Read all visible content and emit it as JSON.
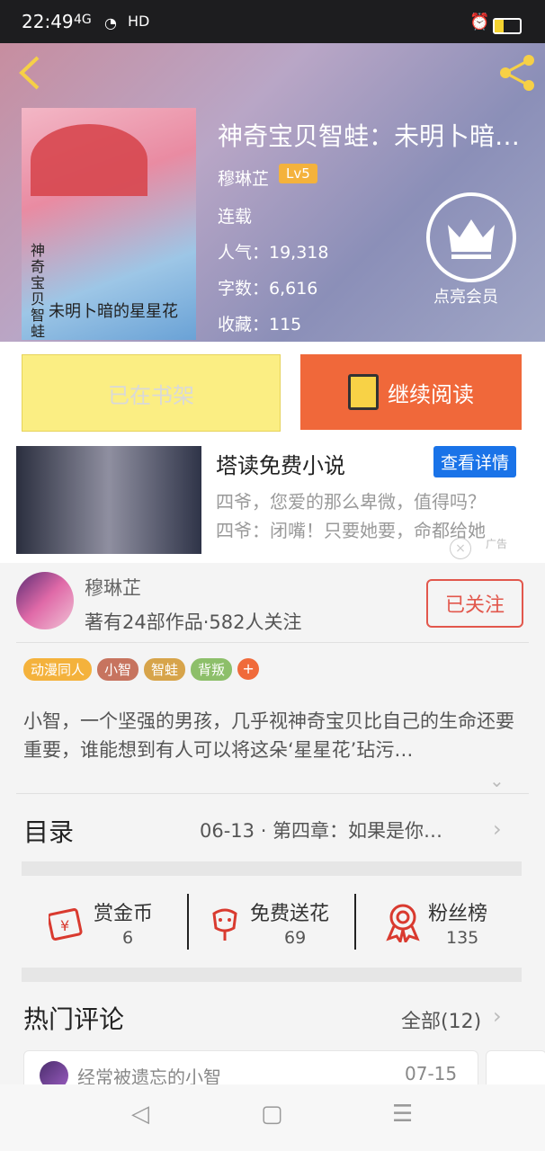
{
  "status_bar": {
    "time": "22:49",
    "network": "4G",
    "hd": "HD"
  },
  "book": {
    "title": "神奇宝贝智蛙：未明卜暗…",
    "author": "穆琳芷",
    "level": "Lv5",
    "state": "连载",
    "popularity": "人气：19,318",
    "words": "字数：6,616",
    "favorites": "收藏：115",
    "member_label": "点亮会员",
    "cover_vertical_text": "神奇宝贝智蛙",
    "cover_title": "未明卜暗的星星花"
  },
  "actions": {
    "shelf": "已在书架",
    "continue": "继续阅读"
  },
  "ad": {
    "title": "塔读免费小说",
    "detail_button": "查看详情",
    "line1": "四爷，您爱的那么卑微，值得吗？",
    "line2": "四爷：闭嘴！只要她要，命都给她",
    "tag": "广告",
    "close": "×"
  },
  "author_info": {
    "name": "穆琳芷",
    "stats": "著有24部作品·582人关注",
    "follow_label": "已关注"
  },
  "tags": [
    {
      "label": "动漫同人",
      "color": "#f4b23c"
    },
    {
      "label": "小智",
      "color": "#c7745f"
    },
    {
      "label": "智蛙",
      "color": "#d7a44a"
    },
    {
      "label": "背叛",
      "color": "#8dbf6a"
    }
  ],
  "tag_more": "+",
  "description": "小智，一个坚强的男孩，几乎视神奇宝贝比自己的生命还要重要，谁能想到有人可以将这朵‘星星花’玷污…",
  "toc": {
    "label": "目录",
    "latest": "06-13 · 第四章：如果是你…"
  },
  "stats": [
    {
      "label": "赏金币",
      "value": "6"
    },
    {
      "label": "免费送花",
      "value": "69"
    },
    {
      "label": "粉丝榜",
      "value": "135"
    }
  ],
  "comments": {
    "label": "热门评论",
    "all": "全部(12)",
    "first": {
      "name": "经常被遗忘的小智",
      "date": "07-15"
    }
  },
  "colors": {
    "accent": "#f0683a",
    "shelf_button": "#fbee83",
    "follow": "#e2574c",
    "link": "#1a73e8"
  },
  "icons": [
    "back-arrow-icon",
    "share-icon",
    "crown-icon",
    "book-icon",
    "coin-icon",
    "flower-icon",
    "medal-icon",
    "chevron-right-icon",
    "chevron-down-icon",
    "nav-back-icon",
    "nav-home-icon",
    "nav-menu-icon"
  ]
}
